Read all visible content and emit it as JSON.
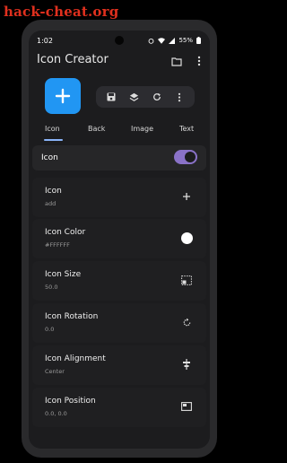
{
  "watermark": "hack-cheat.org",
  "status": {
    "time": "1:02",
    "battery": "55%"
  },
  "appbar": {
    "title": "Icon Creator",
    "folder_icon": "folder-icon",
    "menu_icon": "more-vert-icon"
  },
  "fab": {
    "icon": "add-icon",
    "color": "#2196f3"
  },
  "toolbar": {
    "icons": [
      "save-icon",
      "layers-icon",
      "refresh-icon",
      "more-vert-icon"
    ]
  },
  "tabs": [
    {
      "label": "Icon",
      "active": true
    },
    {
      "label": "Back",
      "active": false
    },
    {
      "label": "Image",
      "active": false
    },
    {
      "label": "Text",
      "active": false
    }
  ],
  "toggle": {
    "label": "Icon",
    "on": true,
    "color": "#8a72c8"
  },
  "rows": [
    {
      "title": "Icon",
      "value": "add",
      "icon": "add-icon"
    },
    {
      "title": "Icon Color",
      "value": "#FFFFFF",
      "icon": "color-swatch"
    },
    {
      "title": "Icon Size",
      "value": "50.0",
      "icon": "resize-icon"
    },
    {
      "title": "Icon Rotation",
      "value": "0.0",
      "icon": "rotate-icon"
    },
    {
      "title": "Icon Alignment",
      "value": "Center",
      "icon": "align-center-icon"
    },
    {
      "title": "Icon Position",
      "value": "0.0, 0.0",
      "icon": "position-icon"
    }
  ],
  "colors": {
    "accent": "#8ab4f8",
    "swatch": "#FFFFFF"
  }
}
